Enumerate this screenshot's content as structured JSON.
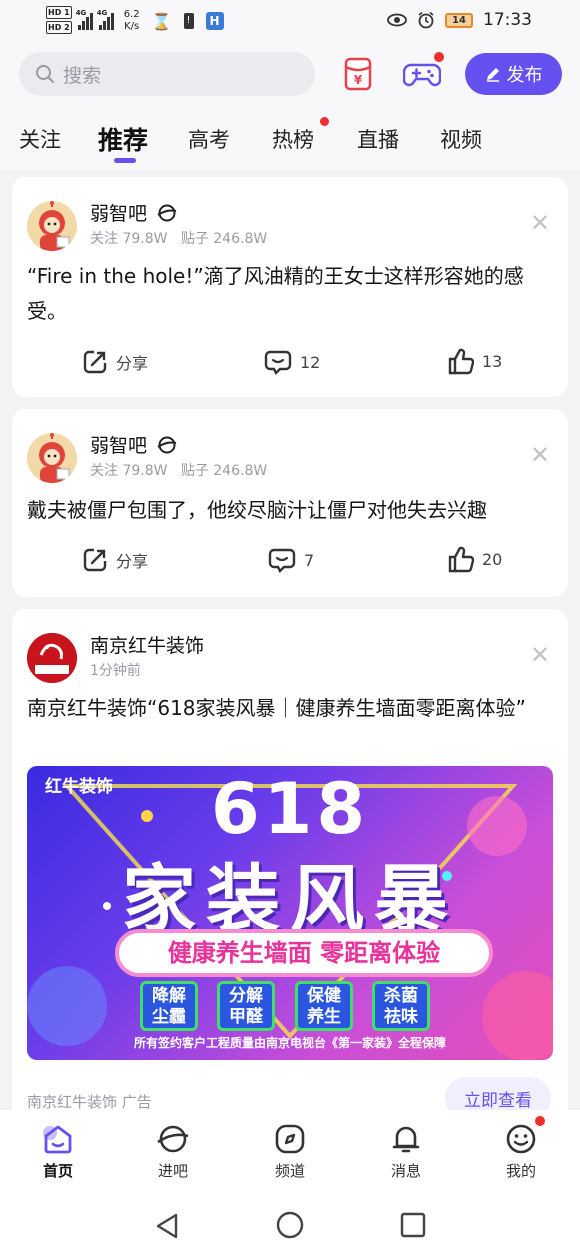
{
  "status_bar": {
    "hd1": "HD 1",
    "hd2": "HD 2",
    "net1": "4G",
    "net2": "4G",
    "speed_value": "6.2",
    "speed_unit": "K/s",
    "battery": "14",
    "time": "17:33"
  },
  "header": {
    "search_placeholder": "搜索",
    "publish_label": "发布"
  },
  "tabs": [
    "关注",
    "推荐",
    "高考",
    "热榜",
    "直播",
    "视频"
  ],
  "posts": [
    {
      "forum": "弱智吧",
      "followers": "关注 79.8W",
      "posts_count": "贴子 246.8W",
      "text": "“Fire in the hole!”滴了风油精的王女士这样形容她的感受。",
      "share": "分享",
      "comments": "12",
      "likes": "13"
    },
    {
      "forum": "弱智吧",
      "followers": "关注 79.8W",
      "posts_count": "贴子 246.8W",
      "text": "戴夫被僵尸包围了，他绞尽脑汁让僵尸对他失去兴趣",
      "share": "分享",
      "comments": "7",
      "likes": "20"
    }
  ],
  "ad": {
    "advertiser": "南京红牛装饰",
    "time": "1分钟前",
    "text": "南京红牛装饰“618家装风暴｜健康养生墙面零距离体验”",
    "banner_brand": "红牛装饰",
    "banner_number": "618",
    "banner_title": "家装风暴",
    "banner_subtitle": "健康养生墙面 零距离体验",
    "banner_boxes": [
      "降解\n尘霾",
      "分解\n甲醛",
      "保健\n养生",
      "杀菌\n祛味"
    ],
    "banner_footer": "所有签约客户工程质量由南京电视台《第一家装》全程保障",
    "label": "南京红牛装饰  广告",
    "cta": "立即查看"
  },
  "bottom_nav": [
    "首页",
    "进吧",
    "频道",
    "消息",
    "我的"
  ],
  "colors": {
    "accent": "#6550f0",
    "red_dot": "#f02d2d",
    "background": "#f3f3f6"
  }
}
